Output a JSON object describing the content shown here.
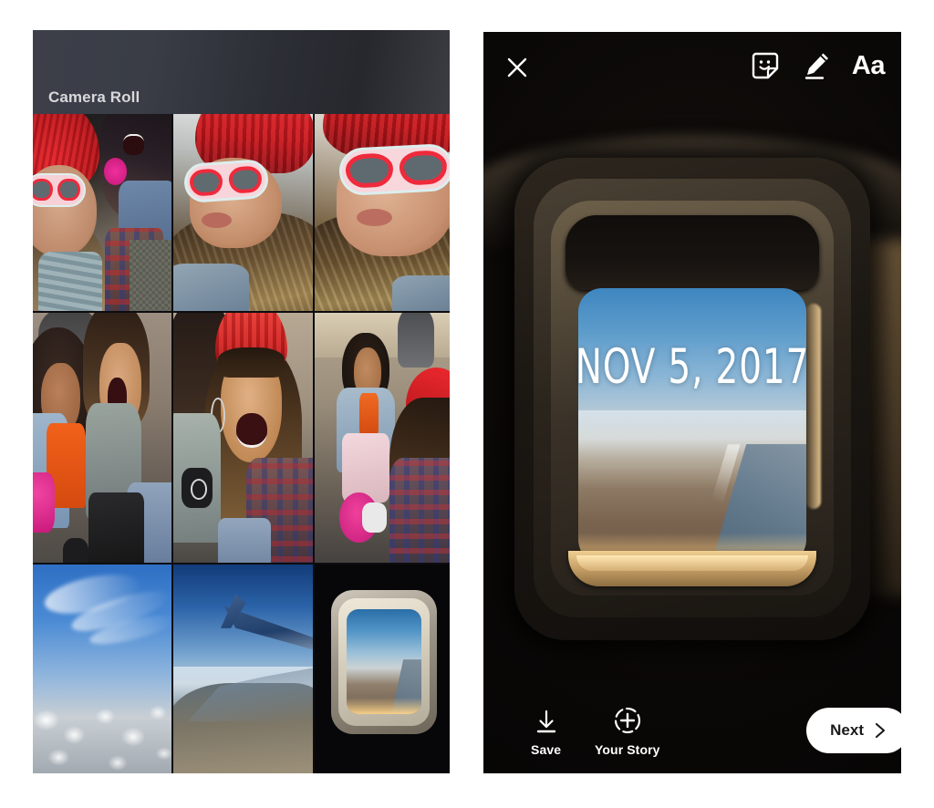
{
  "gallery": {
    "title": "Camera Roll",
    "thumbnails": [
      {
        "id": "thumb-1",
        "description": "Two friends with red beanie and pink heart sunglasses"
      },
      {
        "id": "thumb-2",
        "description": "Girl in red beanie wearing pink heart sunglasses"
      },
      {
        "id": "thumb-3",
        "description": "Close-up of pink heart sunglasses and red beanie"
      },
      {
        "id": "thumb-4",
        "description": "Two friends screaming at the airport"
      },
      {
        "id": "thumb-5",
        "description": "Laughing girl in red beanie at the airport"
      },
      {
        "id": "thumb-6",
        "description": "Friend walking through airport with luggage"
      },
      {
        "id": "thumb-7",
        "description": "Clouds seen from an airplane"
      },
      {
        "id": "thumb-8",
        "description": "Airplane wing above the coastline"
      },
      {
        "id": "thumb-9",
        "description": "View of the coast from an airplane window"
      }
    ]
  },
  "editor": {
    "photo_description": "View of the coastline from an airplane window",
    "sticker_overlay_text": "NOV 5, 2017",
    "top_bar": {
      "close_label": "Close",
      "sticker_label": "Stickers",
      "draw_label": "Draw",
      "text_label": "Aa"
    },
    "bottom_bar": {
      "save_label": "Save",
      "story_label": "Your Story",
      "next_label": "Next"
    }
  },
  "colors": {
    "panel_background": "#000000",
    "gallery_header": "#3c3f49",
    "next_button": "#ffffff",
    "next_button_text": "#1a1a1a",
    "overlay_text": "#ffffff"
  }
}
